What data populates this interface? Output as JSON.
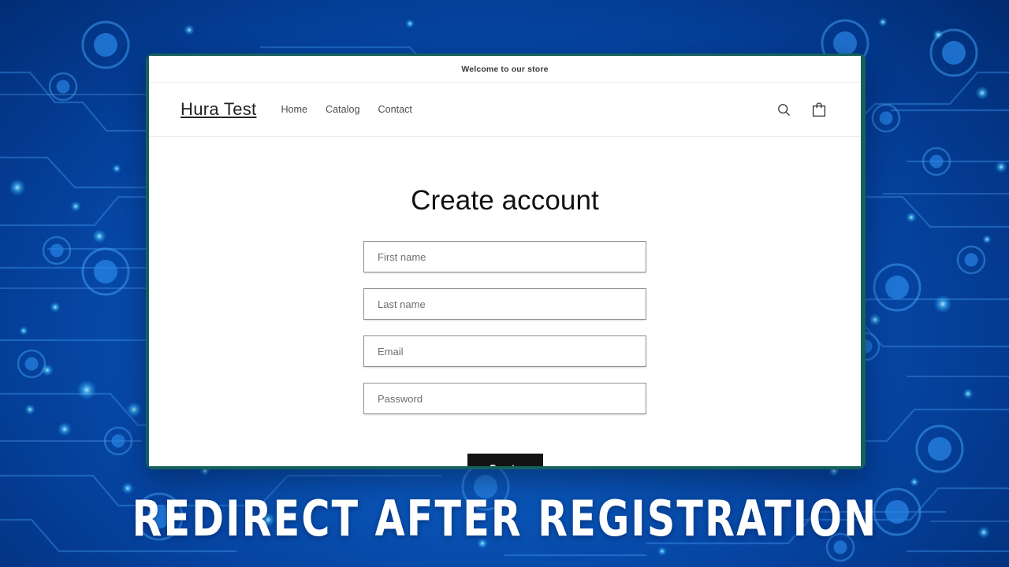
{
  "background": {
    "style": "blue-circuit-board",
    "base_color": "#0a56b8",
    "accent_color": "#2f8fe8"
  },
  "browser": {
    "frame_color": "#16615c",
    "page_background": "#ffffff"
  },
  "store": {
    "announcement": "Welcome to our store",
    "logo": "Hura Test",
    "nav": [
      {
        "label": "Home"
      },
      {
        "label": "Catalog"
      },
      {
        "label": "Contact"
      }
    ],
    "actions": [
      {
        "name": "search-icon",
        "label": "Search"
      },
      {
        "name": "cart-icon",
        "label": "Cart"
      }
    ]
  },
  "main": {
    "title": "Create account",
    "fields": [
      {
        "name": "first-name",
        "placeholder": "First name",
        "value": "",
        "type": "text"
      },
      {
        "name": "last-name",
        "placeholder": "Last name",
        "value": "",
        "type": "text"
      },
      {
        "name": "email",
        "placeholder": "Email",
        "value": "",
        "type": "email"
      },
      {
        "name": "password",
        "placeholder": "Password",
        "value": "",
        "type": "password"
      }
    ],
    "submit_label": "Create"
  },
  "banner": {
    "headline": "Redirect after registration",
    "text_color": "#ffffff"
  }
}
